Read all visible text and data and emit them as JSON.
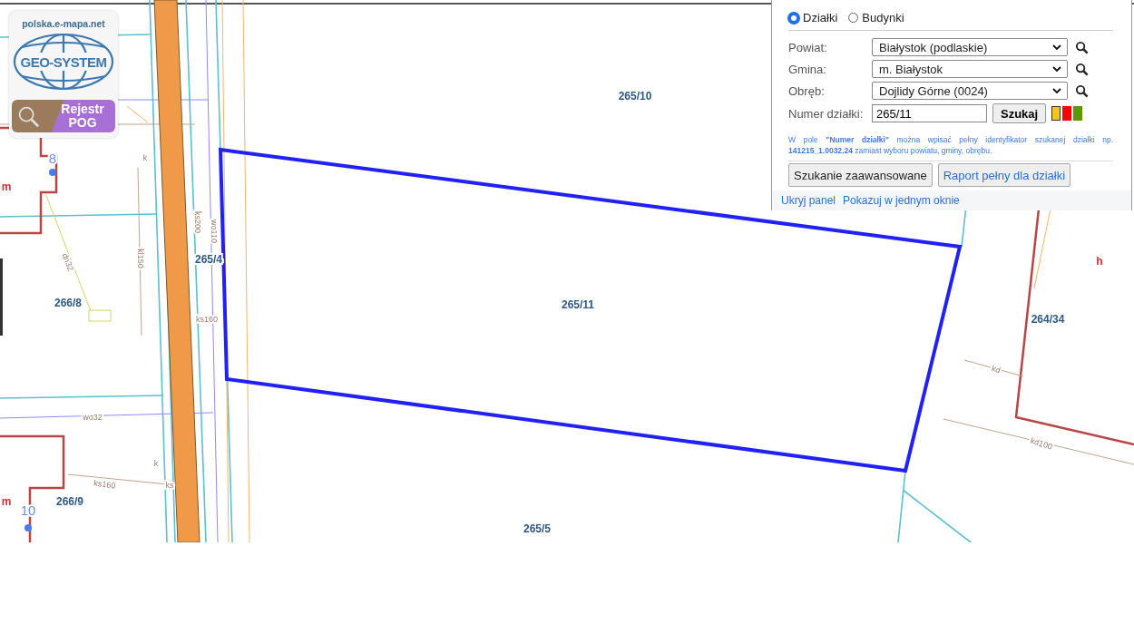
{
  "logo": {
    "site": "polska.e-mapa.net",
    "brand": "GEO-SYSTEM",
    "register_tile": "Rejestr POG"
  },
  "map": {
    "parcel_labels": [
      "265/10",
      "265/4",
      "266/8",
      "265/11",
      "264/34",
      "266/9",
      "265/5"
    ],
    "annotations": [
      {
        "text": "8",
        "kind": "point"
      },
      {
        "text": "10",
        "kind": "point"
      },
      {
        "text": "m",
        "kind": "symbol"
      },
      {
        "text": "m",
        "kind": "symbol"
      },
      {
        "text": "h",
        "kind": "symbol"
      },
      {
        "text": "ks160",
        "kind": "utility"
      },
      {
        "text": "ks160",
        "kind": "utility"
      },
      {
        "text": "wo32",
        "kind": "utility"
      },
      {
        "text": "kd",
        "kind": "utility"
      },
      {
        "text": "kd100",
        "kind": "utility"
      },
      {
        "text": "ks200",
        "kind": "utility"
      },
      {
        "text": "wo110",
        "kind": "utility"
      },
      {
        "text": "kl150",
        "kind": "utility"
      },
      {
        "text": "dn32",
        "kind": "utility"
      },
      {
        "text": "k",
        "kind": "utility"
      },
      {
        "text": "k",
        "kind": "utility"
      },
      {
        "text": "ks",
        "kind": "utility"
      }
    ]
  },
  "search_panel": {
    "mode_options": [
      {
        "label": "Działki",
        "selected": true
      },
      {
        "label": "Budynki",
        "selected": false
      }
    ],
    "fields": [
      {
        "label": "Powiat:",
        "value": "Białystok (podlaskie)",
        "kind": "select"
      },
      {
        "label": "Gmina:",
        "value": "m. Białystok",
        "kind": "select"
      },
      {
        "label": "Obręb:",
        "value": "Dojlidy Górne (0024)",
        "kind": "select"
      },
      {
        "label": "Numer działki:",
        "value": "265/11",
        "kind": "input"
      }
    ],
    "search_button": "Szukaj",
    "color_swatches": [
      {
        "color": "#f5c518",
        "selected": true
      },
      {
        "color": "#ff0000",
        "selected": false
      },
      {
        "color": "#5a9a00",
        "selected": false
      }
    ],
    "hint": "W pole **\"Numer działki\"** można wpisać pełny identyfikator szukanej działki np. **141215_1.0032.24** zamiast wyboru powiatu, gminy, obrębu.",
    "buttons": [
      {
        "label": "Szukanie zaawansowane",
        "kind": "default"
      },
      {
        "label": "Raport pełny dla działki",
        "kind": "link"
      }
    ],
    "footer_links": [
      "Ukryj panel",
      "Pokazuj w jednym oknie"
    ]
  }
}
